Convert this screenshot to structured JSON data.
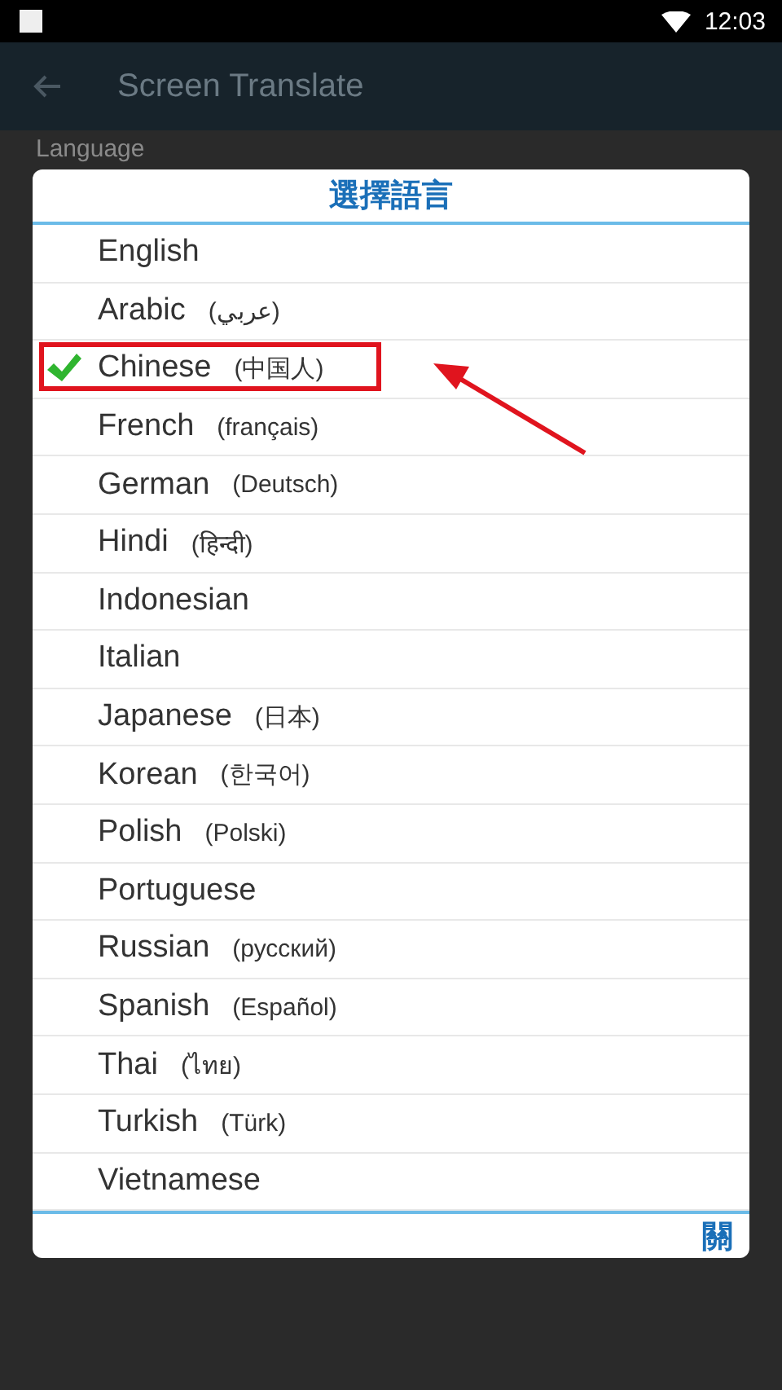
{
  "status_bar": {
    "time": "12:03"
  },
  "app_bar": {
    "title": "Screen Translate"
  },
  "background_label": "Language",
  "dialog": {
    "title": "選擇語言",
    "languages": [
      {
        "name": "English",
        "selected": false
      },
      {
        "name": "Arabic",
        "native": "(عربي)",
        "selected": false
      },
      {
        "name": "Chinese",
        "native": "(中国人)",
        "selected": true
      },
      {
        "name": "French",
        "native": "(français)",
        "selected": false
      },
      {
        "name": "German",
        "native": "(Deutsch)",
        "selected": false
      },
      {
        "name": "Hindi",
        "native": "(हिन्दी)",
        "selected": false
      },
      {
        "name": "Indonesian",
        "selected": false
      },
      {
        "name": "Italian",
        "selected": false
      },
      {
        "name": "Japanese",
        "native": "(日本)",
        "selected": false
      },
      {
        "name": "Korean",
        "native": "(한국어)",
        "selected": false
      },
      {
        "name": "Polish",
        "native": "(Polski)",
        "selected": false
      },
      {
        "name": "Portuguese",
        "selected": false
      },
      {
        "name": "Russian",
        "native": "(русский)",
        "selected": false
      },
      {
        "name": "Spanish",
        "native": "(Español)",
        "selected": false
      },
      {
        "name": "Thai",
        "native": "(ไทย)",
        "selected": false
      },
      {
        "name": "Turkish",
        "native": "(Türk)",
        "selected": false
      },
      {
        "name": "Vietnamese",
        "selected": false
      }
    ],
    "close_button": "關"
  }
}
